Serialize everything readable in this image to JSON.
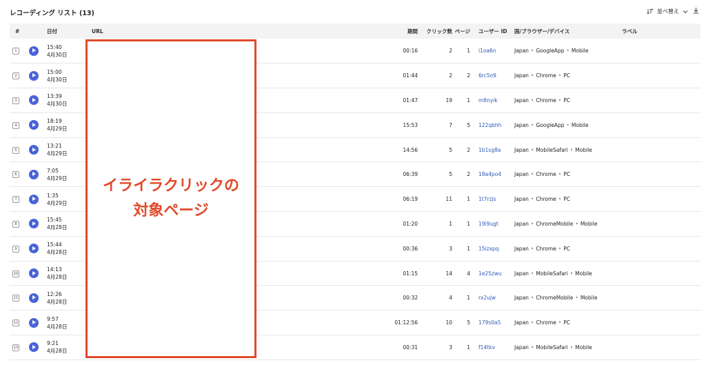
{
  "header": {
    "title": "レコーディング リスト (13)",
    "sort_label": "並べ替え"
  },
  "columns": [
    "#",
    "日付",
    "URL",
    "期間",
    "クリック数",
    "ページ",
    "ユーザー ID",
    "国/ブラウザー/デバイス",
    "ラベル"
  ],
  "rows": [
    {
      "idx": "1",
      "time": "15:40",
      "date": "4月30日",
      "duration": "00:16",
      "clicks": "2",
      "pages": "1",
      "user_id": "i1oa6n",
      "country": "Japan",
      "browser": "GoogleApp",
      "device": "Mobile"
    },
    {
      "idx": "2",
      "time": "15:00",
      "date": "4月30日",
      "duration": "01:44",
      "clicks": "2",
      "pages": "2",
      "user_id": "6rc5o9",
      "country": "Japan",
      "browser": "Chrome",
      "device": "PC"
    },
    {
      "idx": "3",
      "time": "13:39",
      "date": "4月30日",
      "duration": "01:47",
      "clicks": "19",
      "pages": "1",
      "user_id": "m8nyik",
      "country": "Japan",
      "browser": "Chrome",
      "device": "PC"
    },
    {
      "idx": "4",
      "time": "18:19",
      "date": "4月29日",
      "duration": "15:53",
      "clicks": "7",
      "pages": "5",
      "user_id": "122qbhh",
      "country": "Japan",
      "browser": "GoogleApp",
      "device": "Mobile"
    },
    {
      "idx": "5",
      "time": "13:21",
      "date": "4月29日",
      "duration": "14:56",
      "clicks": "5",
      "pages": "2",
      "user_id": "1b1sg8a",
      "country": "Japan",
      "browser": "MobileSafari",
      "device": "Mobile"
    },
    {
      "idx": "6",
      "time": "7:05",
      "date": "4月29日",
      "duration": "06:39",
      "clicks": "5",
      "pages": "2",
      "user_id": "18a4po4",
      "country": "Japan",
      "browser": "Chrome",
      "device": "PC"
    },
    {
      "idx": "7",
      "time": "1:35",
      "date": "4月29日",
      "duration": "06:19",
      "clicks": "11",
      "pages": "1",
      "user_id": "1t7rzjs",
      "country": "Japan",
      "browser": "Chrome",
      "device": "PC"
    },
    {
      "idx": "8",
      "time": "15:45",
      "date": "4月28日",
      "duration": "01:20",
      "clicks": "1",
      "pages": "1",
      "user_id": "19i9ugt",
      "country": "Japan",
      "browser": "ChromeMobile",
      "device": "Mobile"
    },
    {
      "idx": "9",
      "time": "15:44",
      "date": "4月28日",
      "duration": "00:36",
      "clicks": "3",
      "pages": "1",
      "user_id": "15izxpq",
      "country": "Japan",
      "browser": "Chrome",
      "device": "PC"
    },
    {
      "idx": "10",
      "time": "14:13",
      "date": "4月28日",
      "duration": "01:15",
      "clicks": "14",
      "pages": "4",
      "user_id": "1e25zwu",
      "country": "Japan",
      "browser": "MobileSafari",
      "device": "Mobile"
    },
    {
      "idx": "11",
      "time": "12:26",
      "date": "4月28日",
      "duration": "00:32",
      "clicks": "4",
      "pages": "1",
      "user_id": "rx2ujw",
      "country": "Japan",
      "browser": "ChromeMobile",
      "device": "Mobile"
    },
    {
      "idx": "12",
      "time": "9:57",
      "date": "4月28日",
      "duration": "01:12:56",
      "clicks": "10",
      "pages": "5",
      "user_id": "179s0a5",
      "country": "Japan",
      "browser": "Chrome",
      "device": "PC"
    },
    {
      "idx": "13",
      "time": "9:21",
      "date": "4月28日",
      "duration": "00:31",
      "clicks": "3",
      "pages": "1",
      "user_id": "f14tkv",
      "country": "Japan",
      "browser": "MobileSafari",
      "device": "Mobile"
    }
  ],
  "overlay": {
    "line1": "イライラクリックの",
    "line2": "対象ページ"
  },
  "colors": {
    "accent": "#4a63d6",
    "link": "#2f5bb7",
    "annotation": "#e04a2a"
  },
  "icons": {
    "play": "play-icon",
    "sort": "sort-icon",
    "chevron": "chevron-down-icon",
    "download": "download-icon"
  }
}
